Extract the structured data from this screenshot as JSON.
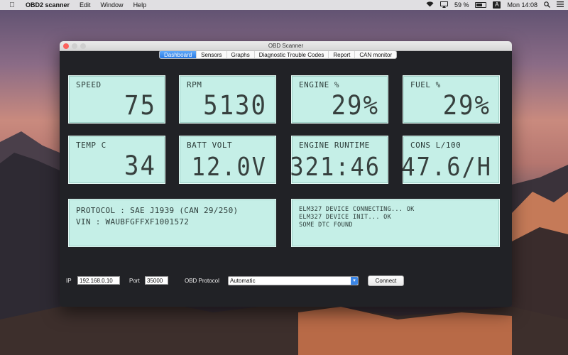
{
  "menubar": {
    "app_name": "OBD2 scanner",
    "items": [
      "Edit",
      "Window",
      "Help"
    ],
    "battery_percent": "59 %",
    "input_source": "A",
    "clock": "Mon 14:08",
    "battery_level": 0.59
  },
  "window": {
    "title": "OBD Scanner",
    "tabs": [
      "Dashboard",
      "Sensors",
      "Graphs",
      "Diagnostic Trouble Codes",
      "Report",
      "CAN monitor"
    ],
    "active_tab": "Dashboard"
  },
  "gauges": {
    "speed": {
      "label": "SPEED",
      "value": "75"
    },
    "rpm": {
      "label": "RPM",
      "value": "5130"
    },
    "engine": {
      "label": "ENGINE %",
      "value": "29%"
    },
    "fuel": {
      "label": "FUEL %",
      "value": "29%"
    },
    "temp": {
      "label": "TEMP C",
      "value": "34"
    },
    "batt": {
      "label": "BATT VOLT",
      "value": "12.0V"
    },
    "runtime": {
      "label": "ENGINE RUNTIME",
      "value": "321:46"
    },
    "cons": {
      "label": "CONS L/100",
      "value": "47.6/H"
    }
  },
  "info": {
    "protocol": "PROTOCOL : SAE J1939 (CAN 29/250)",
    "vin": "VIN : WAUBFGFFXF1001572"
  },
  "log": {
    "lines": [
      "ELM327 DEVICE CONNECTING... OK",
      "ELM327 DEVICE INIT... OK",
      "SOME DTC FOUND"
    ]
  },
  "connection": {
    "ip_label": "IP",
    "ip_value": "192.168.0.10",
    "port_label": "Port",
    "port_value": "35000",
    "protocol_label": "OBD Protocol",
    "protocol_value": "Automatic",
    "connect_label": "Connect"
  },
  "colors": {
    "lcd_background": "#c5efe7",
    "window_background": "#212226",
    "accent": "#2a7ae2"
  }
}
